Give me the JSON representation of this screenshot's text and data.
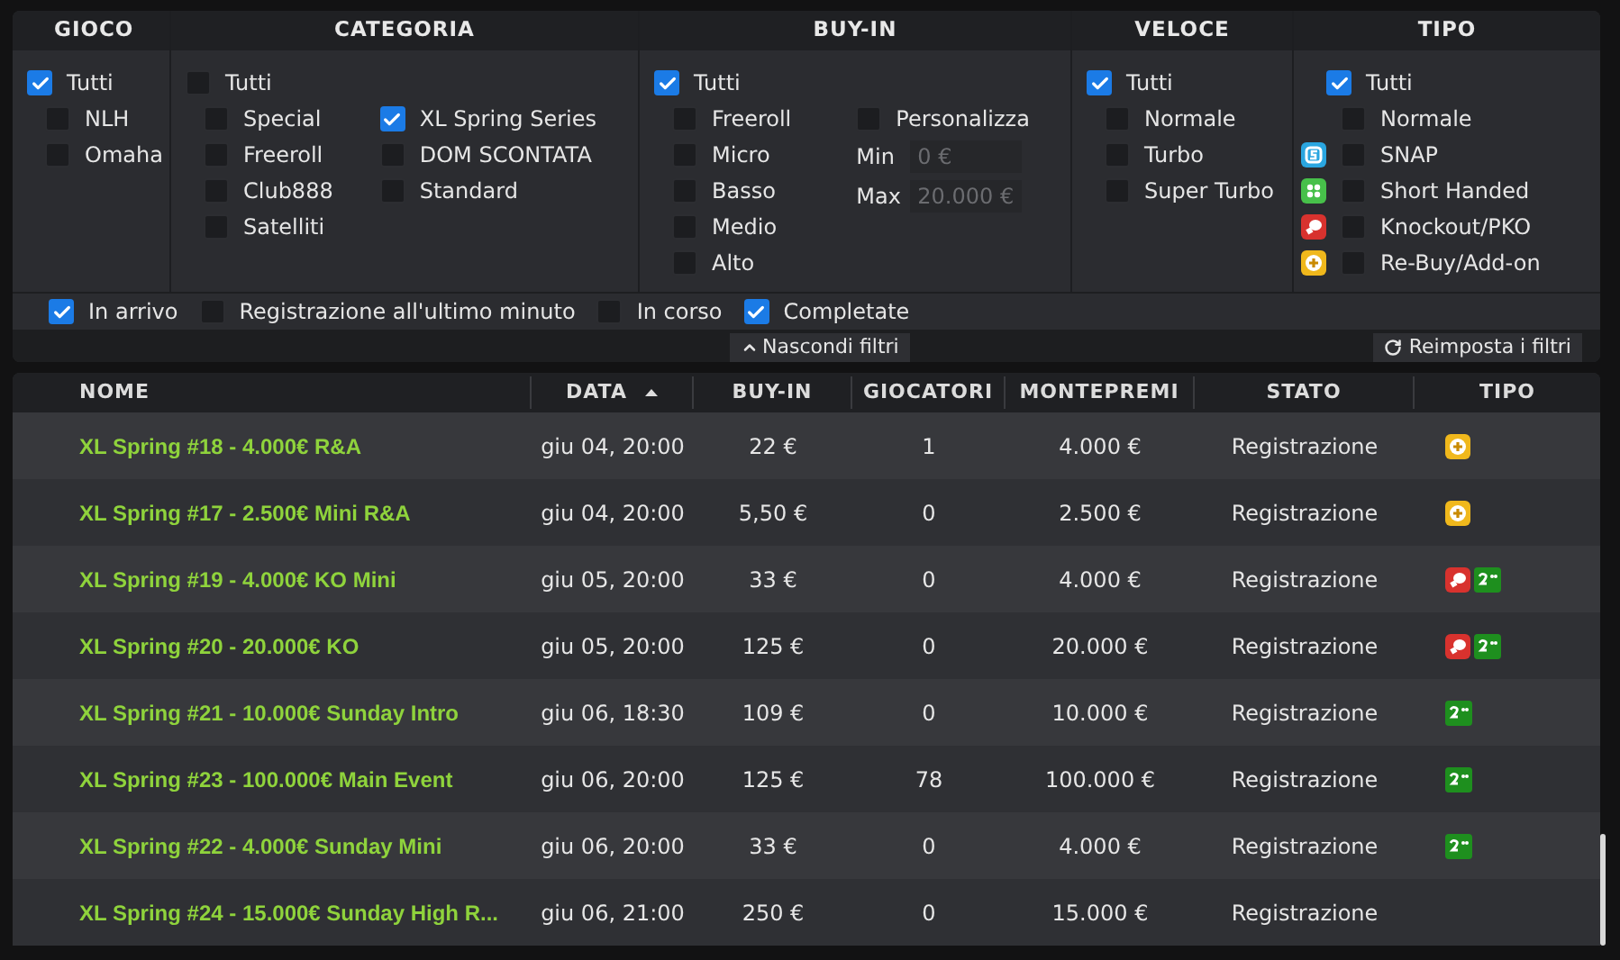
{
  "filters": {
    "sections": [
      {
        "title": "GIOCO",
        "all": {
          "label": "Tutti",
          "checked": true
        },
        "columns": [
          [
            {
              "label": "NLH",
              "checked": false
            },
            {
              "label": "Omaha",
              "checked": false
            }
          ]
        ]
      },
      {
        "title": "CATEGORIA",
        "all": {
          "label": "Tutti",
          "checked": false
        },
        "columns": [
          [
            {
              "label": "Special",
              "checked": false
            },
            {
              "label": "Freeroll",
              "checked": false
            },
            {
              "label": "Club888",
              "checked": false
            },
            {
              "label": "Satelliti",
              "checked": false
            }
          ],
          [
            {
              "label": "XL Spring Series",
              "checked": true
            },
            {
              "label": "DOM SCONTATA",
              "checked": false
            },
            {
              "label": "Standard",
              "checked": false
            }
          ]
        ]
      },
      {
        "title": "BUY-IN",
        "all": {
          "label": "Tutti",
          "checked": true
        },
        "columns": [
          [
            {
              "label": "Freeroll",
              "checked": false
            },
            {
              "label": "Micro",
              "checked": false
            },
            {
              "label": "Basso",
              "checked": false
            },
            {
              "label": "Medio",
              "checked": false
            },
            {
              "label": "Alto",
              "checked": false
            }
          ]
        ],
        "custom": {
          "label": "Personalizza",
          "checked": false,
          "fields": [
            {
              "label": "Min",
              "value": "0 €"
            },
            {
              "label": "Max",
              "value": "20.000 €"
            }
          ]
        }
      },
      {
        "title": "VELOCE",
        "all": {
          "label": "Tutti",
          "checked": true
        },
        "columns": [
          [
            {
              "label": "Normale",
              "checked": false
            },
            {
              "label": "Turbo",
              "checked": false
            },
            {
              "label": "Super Turbo",
              "checked": false
            }
          ]
        ]
      },
      {
        "title": "TIPO",
        "all": {
          "label": "Tutti",
          "checked": true
        },
        "columns": [
          [
            {
              "label": "Normale",
              "checked": false,
              "kind": "none"
            },
            {
              "label": "SNAP",
              "checked": false,
              "kind": "snap"
            },
            {
              "label": "Short Handed",
              "checked": false,
              "kind": "short"
            },
            {
              "label": "Knockout/PKO",
              "checked": false,
              "kind": "knockout"
            },
            {
              "label": "Re-Buy/Add-on",
              "checked": false,
              "kind": "rebuy"
            }
          ]
        ]
      }
    ],
    "status": [
      {
        "label": "In arrivo",
        "checked": true
      },
      {
        "label": "Registrazione all'ultimo minuto",
        "checked": false
      },
      {
        "label": "In corso",
        "checked": false
      },
      {
        "label": "Completate",
        "checked": true
      }
    ],
    "hide_button": "Nascondi filtri",
    "reset_button": "Reimposta i filtri"
  },
  "table": {
    "columns": [
      {
        "label": "NOME",
        "sorted": false
      },
      {
        "label": "DATA",
        "sorted": true
      },
      {
        "label": "BUY-IN",
        "sorted": false
      },
      {
        "label": "GIOCATORI",
        "sorted": false
      },
      {
        "label": "MONTEPREMI",
        "sorted": false
      },
      {
        "label": "STATO",
        "sorted": false
      },
      {
        "label": "TIPO",
        "sorted": false
      }
    ],
    "rows": [
      {
        "cells": [
          "XL Spring #18 - 4.000€ R&A",
          "giu 04, 20:00",
          "22 €",
          "1",
          "4.000 €",
          "Registrazione"
        ],
        "types": [
          {
            "kind": "rebuy"
          }
        ]
      },
      {
        "cells": [
          "XL Spring #17 - 2.500€ Mini R&A",
          "giu 04, 20:00",
          "5,50 €",
          "0",
          "2.500 €",
          "Registrazione"
        ],
        "types": [
          {
            "kind": "rebuy"
          }
        ]
      },
      {
        "cells": [
          "XL Spring #19 - 4.000€ KO Mini",
          "giu 05, 20:00",
          "33 €",
          "0",
          "4.000 €",
          "Registrazione"
        ],
        "types": [
          {
            "kind": "knockout"
          },
          {
            "kind": "second"
          }
        ]
      },
      {
        "cells": [
          "XL Spring #20 - 20.000€ KO",
          "giu 05, 20:00",
          "125 €",
          "0",
          "20.000 €",
          "Registrazione"
        ],
        "types": [
          {
            "kind": "knockout"
          },
          {
            "kind": "second"
          }
        ]
      },
      {
        "cells": [
          "XL Spring #21 - 10.000€ Sunday Intro",
          "giu 06, 18:30",
          "109 €",
          "0",
          "10.000 €",
          "Registrazione"
        ],
        "types": [
          {
            "kind": "second"
          }
        ]
      },
      {
        "cells": [
          "XL Spring #23 - 100.000€ Main Event",
          "giu 06, 20:00",
          "125 €",
          "78",
          "100.000 €",
          "Registrazione"
        ],
        "types": [
          {
            "kind": "second"
          }
        ]
      },
      {
        "cells": [
          "XL Spring #22 - 4.000€ Sunday Mini",
          "giu 06, 20:00",
          "33 €",
          "0",
          "4.000 €",
          "Registrazione"
        ],
        "types": [
          {
            "kind": "second"
          }
        ]
      },
      {
        "cells": [
          "XL Spring #24 - 15.000€ Sunday High R...",
          "giu 06, 21:00",
          "250 €",
          "0",
          "15.000 €",
          "Registrazione"
        ],
        "types": []
      }
    ]
  }
}
